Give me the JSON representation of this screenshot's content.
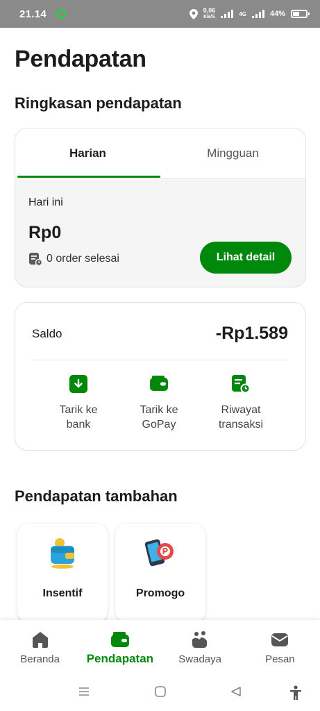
{
  "status_bar": {
    "time": "21.14",
    "speed_value": "0,06",
    "speed_unit": "KB/S",
    "network": "4G",
    "battery": "44%"
  },
  "page": {
    "title": "Pendapatan"
  },
  "summary": {
    "section_title": "Ringkasan pendapatan",
    "tabs": [
      {
        "label": "Harian",
        "active": true
      },
      {
        "label": "Mingguan",
        "active": false
      }
    ],
    "period_label": "Hari ini",
    "amount": "Rp0",
    "orders_text": "0 order selesai",
    "detail_button": "Lihat detail"
  },
  "balance": {
    "label": "Saldo",
    "value": "-Rp1.589",
    "actions": [
      {
        "line1": "Tarik ke",
        "line2": "bank",
        "icon": "download-arrow-icon"
      },
      {
        "line1": "Tarik ke",
        "line2": "GoPay",
        "icon": "wallet-icon"
      },
      {
        "line1": "Riwayat",
        "line2": "transaksi",
        "icon": "transaction-history-icon"
      }
    ]
  },
  "extra": {
    "section_title": "Pendapatan tambahan",
    "items": [
      {
        "label": "Insentif",
        "icon": "incentive-wallet-illustration"
      },
      {
        "label": "Promogo",
        "icon": "promogo-phone-illustration"
      }
    ]
  },
  "bottom_nav": {
    "items": [
      {
        "label": "Beranda",
        "icon": "home-icon",
        "active": false
      },
      {
        "label": "Pendapatan",
        "icon": "wallet-icon",
        "active": true
      },
      {
        "label": "Swadaya",
        "icon": "swadaya-icon",
        "active": false
      },
      {
        "label": "Pesan",
        "icon": "message-icon",
        "active": false
      }
    ]
  },
  "colors": {
    "brand_green": "#00880d",
    "status_bar": "#8a8a8a",
    "card_bg": "#f5f5f5"
  }
}
